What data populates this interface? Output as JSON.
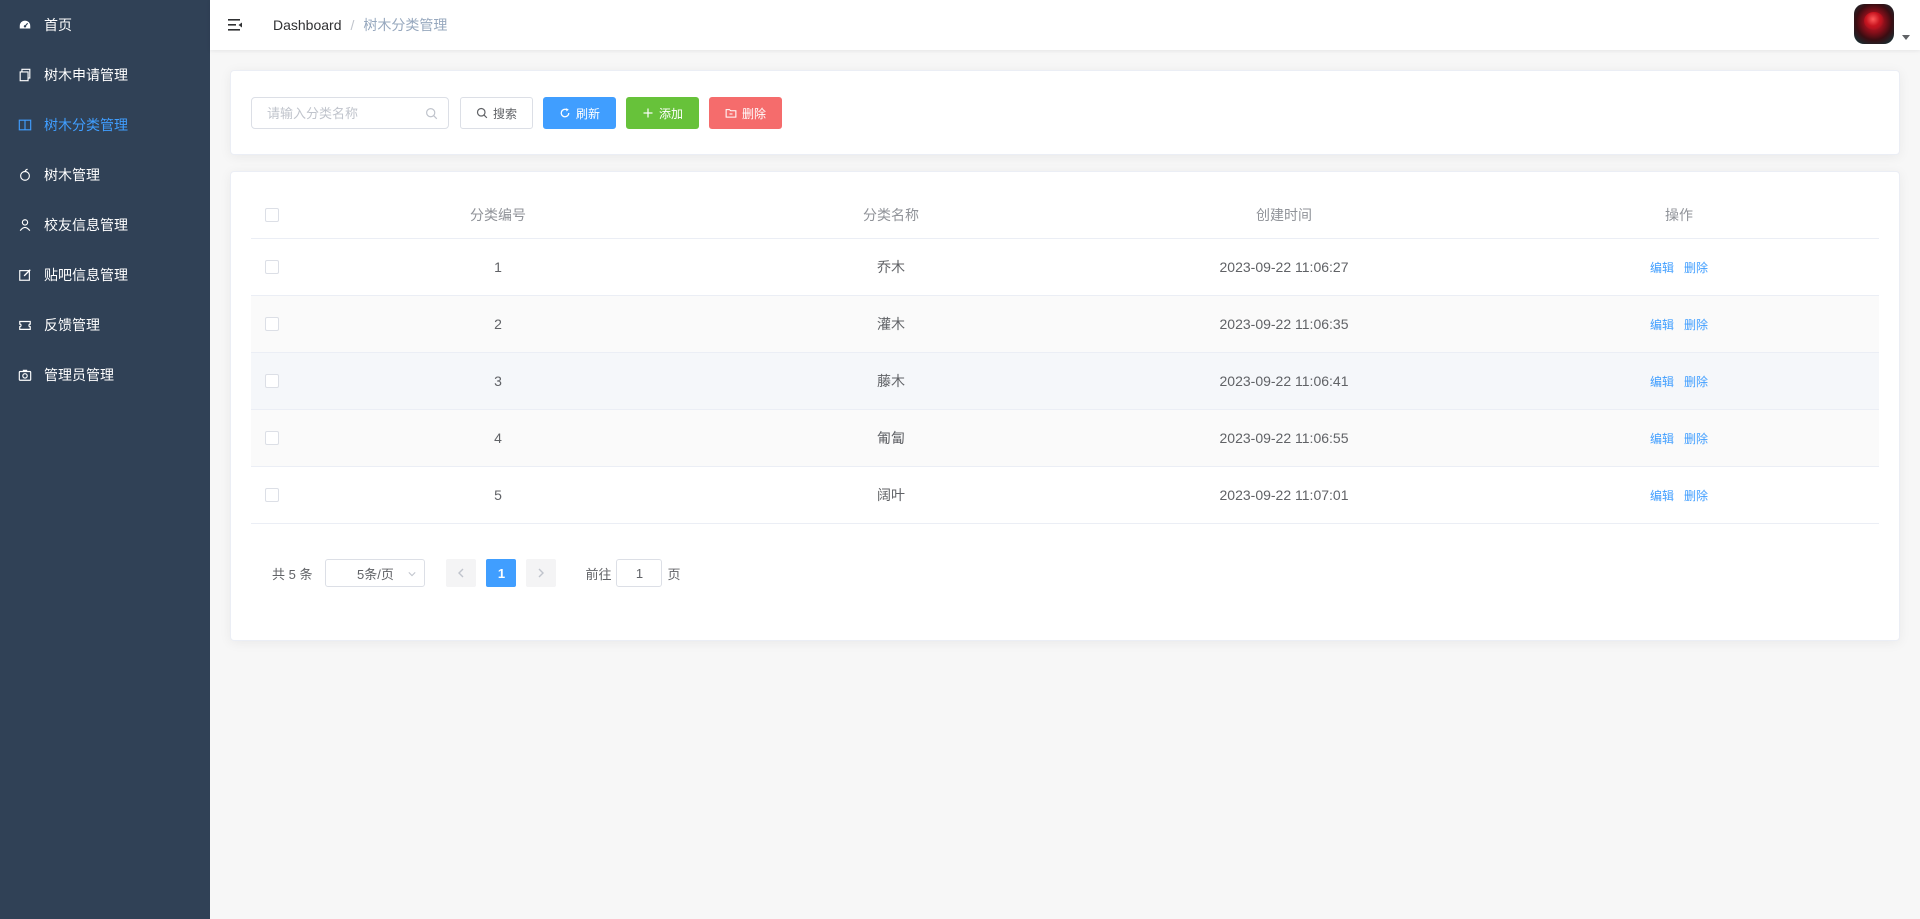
{
  "sidebar": {
    "items": [
      {
        "label": "首页",
        "icon": "dashboard-icon",
        "active": false
      },
      {
        "label": "树木申请管理",
        "icon": "copy-document-icon",
        "active": false
      },
      {
        "label": "树木分类管理",
        "icon": "notebook-icon",
        "active": true
      },
      {
        "label": "树木管理",
        "icon": "apple-icon",
        "active": false
      },
      {
        "label": "校友信息管理",
        "icon": "user-icon",
        "active": false
      },
      {
        "label": "贴吧信息管理",
        "icon": "edit-icon",
        "active": false
      },
      {
        "label": "反馈管理",
        "icon": "ticket-icon",
        "active": false
      },
      {
        "label": "管理员管理",
        "icon": "camera-icon",
        "active": false
      }
    ]
  },
  "header": {
    "breadcrumb_root": "Dashboard",
    "breadcrumb_separator": "/",
    "breadcrumb_current": "树木分类管理"
  },
  "toolbar": {
    "search_placeholder": "请输入分类名称",
    "search_value": "",
    "search_label": "搜索",
    "refresh_label": "刷新",
    "add_label": "添加",
    "delete_label": "删除"
  },
  "table": {
    "columns": [
      "分类编号",
      "分类名称",
      "创建时间",
      "操作"
    ],
    "rows": [
      {
        "id": "1",
        "name": "乔木",
        "created": "2023-09-22 11:06:27"
      },
      {
        "id": "2",
        "name": "灌木",
        "created": "2023-09-22 11:06:35"
      },
      {
        "id": "3",
        "name": "藤木",
        "created": "2023-09-22 11:06:41"
      },
      {
        "id": "4",
        "name": "匍匐",
        "created": "2023-09-22 11:06:55"
      },
      {
        "id": "5",
        "name": "阔叶",
        "created": "2023-09-22 11:07:01"
      }
    ],
    "edit_label": "编辑",
    "delete_label": "删除"
  },
  "pagination": {
    "total_text": "共 5 条",
    "page_size": "5条/页",
    "current_page": "1",
    "goto_label": "前往",
    "goto_value": "1",
    "page_unit": "页"
  },
  "colors": {
    "sidebar_bg": "#304156",
    "accent": "#409eff",
    "success": "#67c23a",
    "danger": "#f56c6c"
  }
}
